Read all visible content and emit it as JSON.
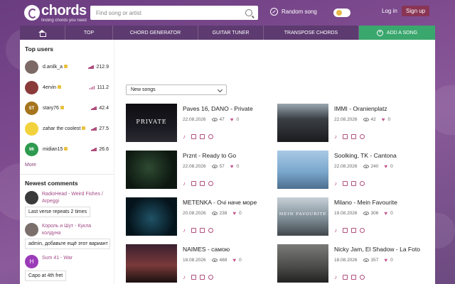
{
  "header": {
    "logo_name": "chords",
    "logo_tagline": "finding chords you need",
    "search_placeholder": "Find song or artist",
    "random_label": "Random song",
    "login_label": "Log in",
    "signup_label": "Sign up"
  },
  "nav": {
    "home_icon": "home-icon",
    "top": "TOP",
    "chord_generator": "CHORD GENERATOR",
    "guitar_tuner": "GUITAR TUNER",
    "transpose_chords": "TRANSPOSE CHORDS",
    "add_song": "ADD A SONG"
  },
  "sidebar": {
    "top_users_title": "Top users",
    "users": [
      {
        "name": "d.anilk_a",
        "score": "212.9",
        "avatar": "",
        "avatar_color": "#7d6a66"
      },
      {
        "name": "4ervin",
        "score": "111.2",
        "avatar": "",
        "avatar_color": "#8b3a3a"
      },
      {
        "name": "stary76",
        "score": "42.4",
        "avatar": "ST",
        "avatar_color": "#a5741c"
      },
      {
        "name": "zahar the coolest",
        "score": "27.5",
        "avatar": "",
        "avatar_color": "#f2d23c"
      },
      {
        "name": "midian15",
        "score": "26.6",
        "avatar": "MI",
        "avatar_color": "#2e9a4e"
      }
    ],
    "more_label": "More",
    "newest_comments_title": "Newest comments",
    "comments": [
      {
        "song": "RadioHead - Weird Fishes / Arpeggi",
        "text": "Last verse repeats 2 times",
        "avatar": "",
        "avatar_color": "#3a3a3a"
      },
      {
        "song": "Король и Шут - Кукла колдуна",
        "text": "admin, добавьте ещё этот вариант",
        "avatar": "",
        "avatar_color": "#7a6f6a"
      },
      {
        "song": "Sum 41 - War",
        "text": "Capo at 4th fret",
        "avatar": "H",
        "avatar_color": "#9b3bb8"
      }
    ]
  },
  "main": {
    "sort_select_value": "New songs",
    "songs": [
      {
        "title": "Paves 16, DANO - Private",
        "date": "22.08.2026",
        "views": "47",
        "likes": "0",
        "thumb_text": "PRIVATE"
      },
      {
        "title": "IMMI - Oranienplatz",
        "date": "22.08.2026",
        "views": "42",
        "likes": "0",
        "thumb_text": ""
      },
      {
        "title": "Prznt - Ready to Go",
        "date": "22.08.2026",
        "views": "57",
        "likes": "0",
        "thumb_text": ""
      },
      {
        "title": "Soolking, TK - Cantona",
        "date": "22.08.2026",
        "views": "240",
        "likes": "0",
        "thumb_text": ""
      },
      {
        "title": "METENKA - Очі наче море",
        "date": "20.08.2026",
        "views": "238",
        "likes": "0",
        "thumb_text": ""
      },
      {
        "title": "Milano - Mein Favourite",
        "date": "19.08.2026",
        "views": "306",
        "likes": "0",
        "thumb_text": "MEIN FAVOURITE"
      },
      {
        "title": "NAIMES - самою",
        "date": "18.08.2026",
        "views": "488",
        "likes": "0",
        "thumb_text": ""
      },
      {
        "title": "Nicky Jam, El Shadow - La Foto",
        "date": "18.08.2026",
        "views": "357",
        "likes": "0",
        "thumb_text": ""
      }
    ]
  },
  "colors": {
    "brand_purple": "#7b4b8f",
    "nav_bg": "#5d3a70",
    "add_button": "#3aa76d",
    "signup": "#8a3555",
    "accent_pink": "#b04f7e"
  }
}
